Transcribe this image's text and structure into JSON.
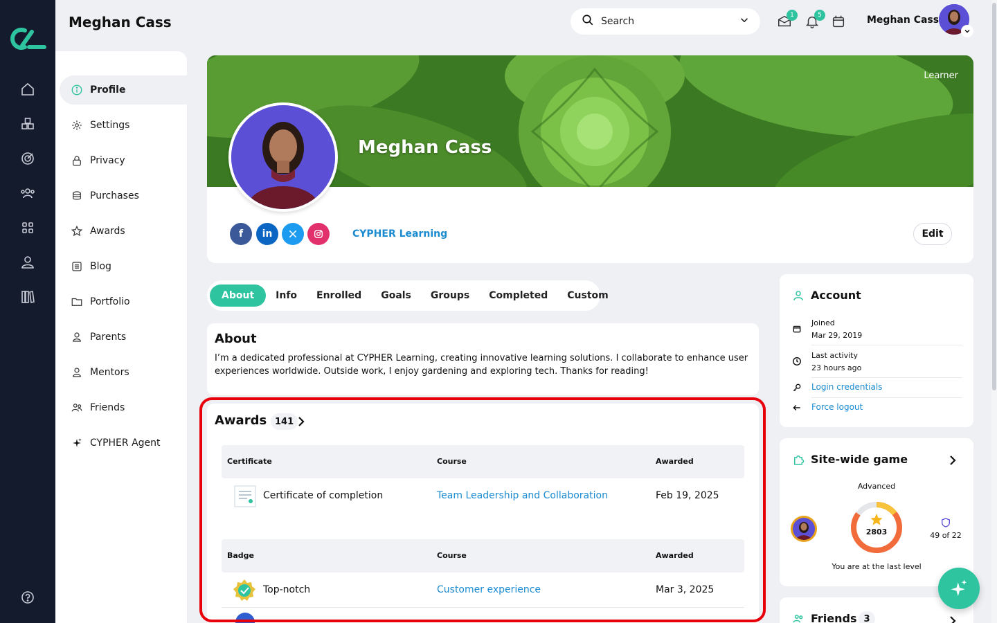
{
  "header": {
    "page_title": "Meghan Cass",
    "search_placeholder": "Search",
    "mail_badge": "1",
    "notification_badge": "5",
    "user_name": "Meghan Cass"
  },
  "sidenav": {
    "items": [
      {
        "label": "Profile",
        "icon": "info-icon",
        "active": true
      },
      {
        "label": "Settings",
        "icon": "gear-icon"
      },
      {
        "label": "Privacy",
        "icon": "lock-icon"
      },
      {
        "label": "Purchases",
        "icon": "coins-icon"
      },
      {
        "label": "Awards",
        "icon": "star-icon"
      },
      {
        "label": "Blog",
        "icon": "list-icon"
      },
      {
        "label": "Portfolio",
        "icon": "folder-icon"
      },
      {
        "label": "Parents",
        "icon": "person-icon"
      },
      {
        "label": "Mentors",
        "icon": "person-icon"
      },
      {
        "label": "Friends",
        "icon": "friends-icon"
      },
      {
        "label": "CYPHER Agent",
        "icon": "sparkle-icon"
      }
    ]
  },
  "profile": {
    "role": "Learner",
    "name": "Meghan Cass",
    "organization": "CYPHER Learning",
    "edit_label": "Edit",
    "social": [
      "facebook-icon",
      "linkedin-icon",
      "x-icon",
      "instagram-icon"
    ]
  },
  "tabs": [
    {
      "label": "About",
      "active": true
    },
    {
      "label": "Info"
    },
    {
      "label": "Enrolled"
    },
    {
      "label": "Goals"
    },
    {
      "label": "Groups"
    },
    {
      "label": "Completed"
    },
    {
      "label": "Custom"
    }
  ],
  "about": {
    "title": "About",
    "text": "I’m a dedicated professional at CYPHER Learning, creating innovative learning solutions. I collaborate to enhance user experiences worldwide. Outside work, I enjoy gardening and exploring tech. Thanks for reading!"
  },
  "awards": {
    "title": "Awards",
    "count": "141",
    "certificates": {
      "headers": [
        "Certificate",
        "Course",
        "Awarded"
      ],
      "rows": [
        {
          "name": "Certificate of completion",
          "course": "Team Leadership and Collaboration",
          "awarded": "Feb 19, 2025"
        }
      ]
    },
    "badges": {
      "headers": [
        "Badge",
        "Course",
        "Awarded"
      ],
      "rows": [
        {
          "name": "Top-notch",
          "course": "Customer experience",
          "awarded": "Mar 3, 2025"
        }
      ]
    }
  },
  "account": {
    "title": "Account",
    "joined_label": "Joined",
    "joined_value": "Mar 29, 2019",
    "activity_label": "Last activity",
    "activity_value": "23 hours ago",
    "login_credentials": "Login credentials",
    "force_logout": "Force logout"
  },
  "game": {
    "title": "Site-wide game",
    "level": "Advanced",
    "points": "2803",
    "rank": "49 of 22",
    "footer": "You are at the last level",
    "progress_fraction": 0.85
  },
  "friends": {
    "title": "Friends",
    "count": "3"
  },
  "colors": {
    "accent": "#2ec4a0",
    "link": "#1a8bd0",
    "rail": "#141b2d",
    "highlight": "#e8000b"
  }
}
